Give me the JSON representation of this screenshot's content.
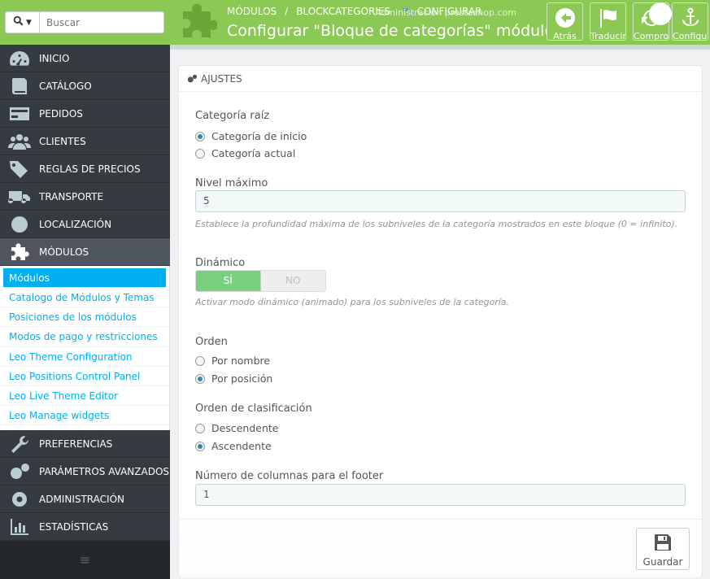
{
  "search": {
    "placeholder": "Buscar"
  },
  "sidebar": {
    "items_top": [
      {
        "label": "Inicio",
        "icon": "dashboard-icon"
      },
      {
        "label": "Catálogo",
        "icon": "book-icon"
      },
      {
        "label": "Pedidos",
        "icon": "credit-card-icon"
      },
      {
        "label": "Clientes",
        "icon": "users-icon"
      },
      {
        "label": "Reglas de precios",
        "icon": "tags-icon"
      },
      {
        "label": "Transporte",
        "icon": "truck-icon"
      },
      {
        "label": "Localización",
        "icon": "globe-icon"
      },
      {
        "label": "Módulos",
        "icon": "puzzle-icon"
      }
    ],
    "submenu": [
      "Módulos",
      "Catalogo de Módulos y Temas",
      "Posiciones de los módulos",
      "Modos de pago y restricciones",
      "Leo Theme Configuration",
      "Leo Positions Control Panel",
      "Leo Live Theme Editor",
      "Leo Manage widgets"
    ],
    "items_bottom": [
      {
        "label": "Preferencias",
        "icon": "wrench-icon"
      },
      {
        "label": "Parámetros avanzados",
        "icon": "cogs-icon"
      },
      {
        "label": "Administración",
        "icon": "cog-icon"
      },
      {
        "label": "Estadísticas",
        "icon": "bar-chart-icon"
      }
    ],
    "footer_icon": "≡"
  },
  "header": {
    "breadcrumb": [
      "Módulos",
      "blockcategories",
      "Configurar"
    ],
    "title": "Configurar \"Bloque de categorías\" módulo",
    "login_text": "Administración prestashop.com",
    "buttons": [
      {
        "label": "Atrás",
        "icon": "back-icon"
      },
      {
        "label": "Traducir",
        "icon": "flag-icon"
      },
      {
        "label": "Comprobar",
        "icon": "refresh-icon"
      },
      {
        "label": "Configurar",
        "icon": "anchor-icon"
      }
    ],
    "accent": "#8bc954"
  },
  "form": {
    "heading": "Ajustes",
    "root_category": {
      "label": "Categoría raíz",
      "options": [
        "Categoría de inicio",
        "Categoría actual"
      ],
      "selected": 0
    },
    "max_depth": {
      "label": "Nivel máximo",
      "value": "5",
      "help": "Establece la profundidad máxima de los subniveles de la categoría mostrados en este bloque (0 = infinito)."
    },
    "dynamic": {
      "label": "Dinámico",
      "yes": "SÍ",
      "no": "NO",
      "value": true,
      "help": "Activar modo dinámico (animado) para los subniveles de la categoría."
    },
    "sort": {
      "label": "Orden",
      "options": [
        "Por nombre",
        "Por posición"
      ],
      "selected": 1
    },
    "sort_way": {
      "label": "Orden de clasificación",
      "options": [
        "Descendente",
        "Ascendente"
      ],
      "selected": 1
    },
    "footer_columns": {
      "label": "Número de columnas para el footer",
      "value": "1"
    },
    "save_label": "Guardar"
  }
}
